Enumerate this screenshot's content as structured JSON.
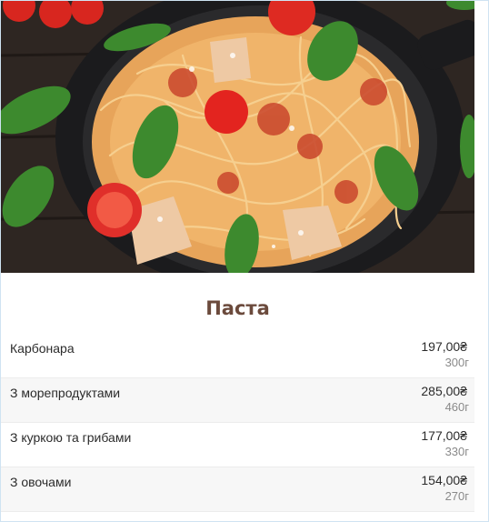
{
  "section": {
    "title": "Паста"
  },
  "menu": {
    "items": [
      {
        "name": "Карбонара",
        "price": "197,00₴",
        "weight": "300г"
      },
      {
        "name": "З морепродуктами",
        "price": "285,00₴",
        "weight": "460г"
      },
      {
        "name": "З куркою та грибами",
        "price": "177,00₴",
        "weight": "330г"
      },
      {
        "name": "З овочами",
        "price": "154,00₴",
        "weight": "270г"
      }
    ]
  },
  "colors": {
    "title": "#6b4a3c",
    "border": "#cfe3f2",
    "alt_row": "#f7f7f7"
  },
  "hero": {
    "icon": "pasta-photo"
  }
}
